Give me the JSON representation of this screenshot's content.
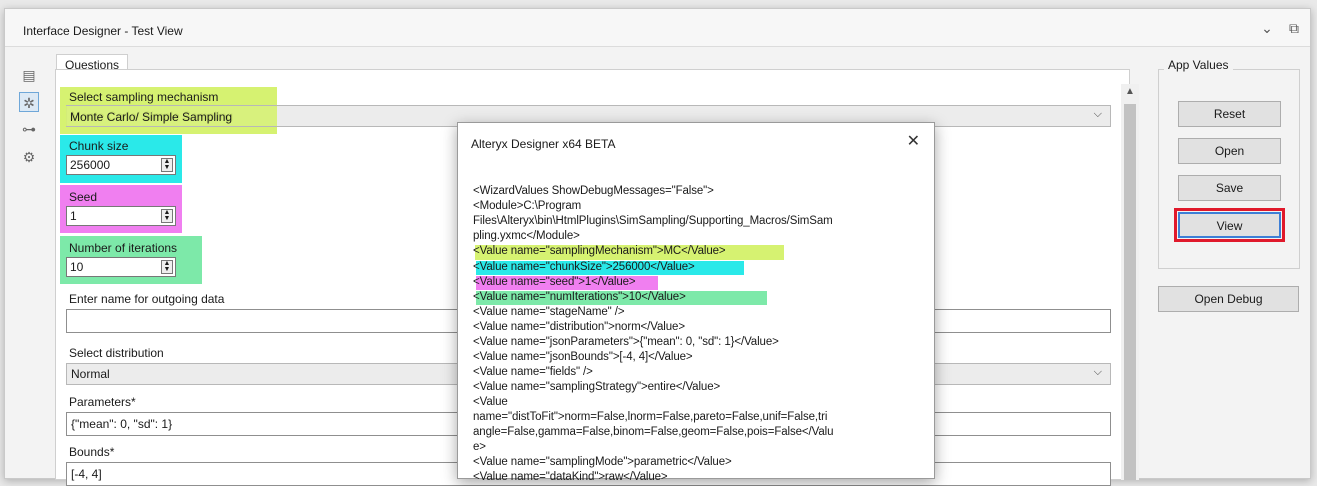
{
  "window": {
    "title": "Interface Designer - Test View"
  },
  "tabs": {
    "questions": "Questions"
  },
  "form": {
    "sampling_label": "Select sampling mechanism",
    "sampling_value": "Monte Carlo/ Simple Sampling",
    "chunk_label": "Chunk size",
    "chunk_value": "256000",
    "seed_label": "Seed",
    "seed_value": "1",
    "iter_label": "Number of iterations",
    "iter_value": "10",
    "name_label": "Enter name for outgoing data",
    "name_value": "",
    "dist_label": "Select distribution",
    "dist_value": "Normal",
    "params_label": "Parameters*",
    "params_value": "{\"mean\": 0, \"sd\": 1}",
    "bounds_label": "Bounds*",
    "bounds_value": "[-4, 4]"
  },
  "app_values": {
    "title": "App Values",
    "reset": "Reset",
    "open": "Open",
    "save": "Save",
    "view": "View",
    "open_debug": "Open Debug"
  },
  "dialog": {
    "title": "Alteryx Designer x64 BETA",
    "lines": [
      "<WizardValues ShowDebugMessages=\"False\">",
      "  <Module>C:\\Program",
      "Files\\Alteryx\\bin\\HtmlPlugins\\SimSampling/Supporting_Macros/SimSam",
      "pling.yxmc</Module>",
      "  <Value name=\"samplingMechanism\">MC</Value>",
      "  <Value name=\"chunkSize\">256000</Value>",
      "  <Value name=\"seed\">1</Value>",
      "  <Value name=\"numIterations\">10</Value>",
      "  <Value name=\"stageName\" />",
      "  <Value name=\"distribution\">norm</Value>",
      "  <Value name=\"jsonParameters\">{\"mean\": 0, \"sd\": 1}</Value>",
      "  <Value name=\"jsonBounds\">[-4, 4]</Value>",
      "  <Value name=\"fields\" />",
      "  <Value name=\"samplingStrategy\">entire</Value>",
      "  <Value",
      "name=\"distToFit\">norm=False,lnorm=False,pareto=False,unif=False,tri",
      "angle=False,gamma=False,binom=False,geom=False,pois=False</Valu",
      "e>",
      "  <Value name=\"samplingMode\">parametric</Value>",
      "  <Value name=\"dataKind\">raw</Value>"
    ]
  },
  "colors": {
    "highlight_green": "#d6f271",
    "highlight_cyan": "#2ae9e9",
    "highlight_pink": "#f07ff0",
    "highlight_mint": "#7de9a9",
    "view_outline_red": "#e0192b"
  },
  "icons": [
    "chevron-down-icon",
    "popout-icon",
    "layout-icon",
    "wand-icon",
    "tree-icon",
    "gear-icon",
    "close-icon",
    "scroll-up-icon"
  ]
}
